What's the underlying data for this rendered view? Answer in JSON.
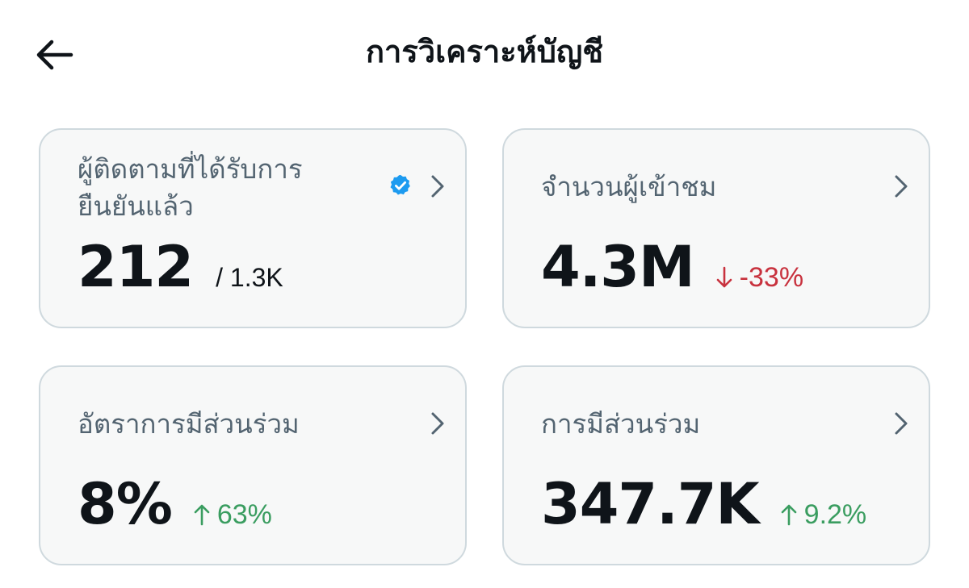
{
  "header": {
    "title": "การวิเคราะห์บัญชี"
  },
  "cards": [
    {
      "label": "ผู้ติดตามที่ได้รับการยืนยันแล้ว",
      "value": "212",
      "secondary": "/ 1.3K"
    },
    {
      "label": "จำนวนผู้เข้าชม",
      "value": "4.3M",
      "trend": "-33%",
      "trend_direction": "down"
    },
    {
      "label": "อัตราการมีส่วนร่วม",
      "value": "8%",
      "trend": "63%",
      "trend_direction": "up"
    },
    {
      "label": "การมีส่วนร่วม",
      "value": "347.7K",
      "trend": "9.2%",
      "trend_direction": "up"
    }
  ],
  "icons": {
    "back": "arrow-left-icon",
    "verified": "verified-badge-icon",
    "chevron": "chevron-right-icon",
    "trend_down": "arrow-down-icon",
    "trend_up": "arrow-up-icon"
  },
  "colors": {
    "verified": "#1d9bf0",
    "down": "#c8323e",
    "up": "#3a9d60",
    "card_bg": "#f7f8f8",
    "card_border": "#cfd9de",
    "label": "#536471",
    "text": "#0f1419"
  }
}
